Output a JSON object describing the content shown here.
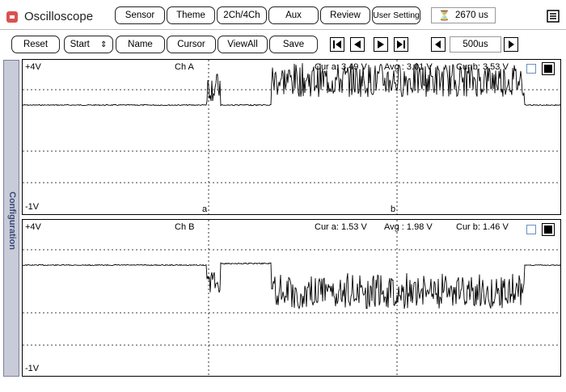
{
  "app": {
    "title": "Oscilloscope",
    "icon": "app-icon"
  },
  "toolbar_top": {
    "sensor": "Sensor",
    "theme": "Theme",
    "channels": "2Ch/4Ch",
    "aux": "Aux",
    "review": "Review",
    "user_setting": "User Setting",
    "time_value": "2670 us"
  },
  "toolbar_bottom": {
    "reset": "Reset",
    "start": "Start",
    "name": "Name",
    "cursor": "Cursor",
    "view_all": "ViewAll",
    "save": "Save",
    "range_value": "500us"
  },
  "sidebar": {
    "label": "Configuration"
  },
  "channels": [
    {
      "name": "Ch A",
      "top_label": "+4V",
      "bottom_label": "-1V",
      "cur_a": "Cur a: 3.49 V",
      "avg": "Avg : 3.01 V",
      "cur_b": "Cur b: 3.53 V",
      "marker_a": "a",
      "marker_b": "b"
    },
    {
      "name": "Ch B",
      "top_label": "+4V",
      "bottom_label": "-1V",
      "cur_a": "Cur a: 1.53 V",
      "avg": "Avg : 1.98 V",
      "cur_b": "Cur b: 1.46 V"
    }
  ],
  "colors": {
    "accent": "#d9534f",
    "sidebar": "#c8cbd8",
    "sidebar_text": "#3a4a7a"
  }
}
